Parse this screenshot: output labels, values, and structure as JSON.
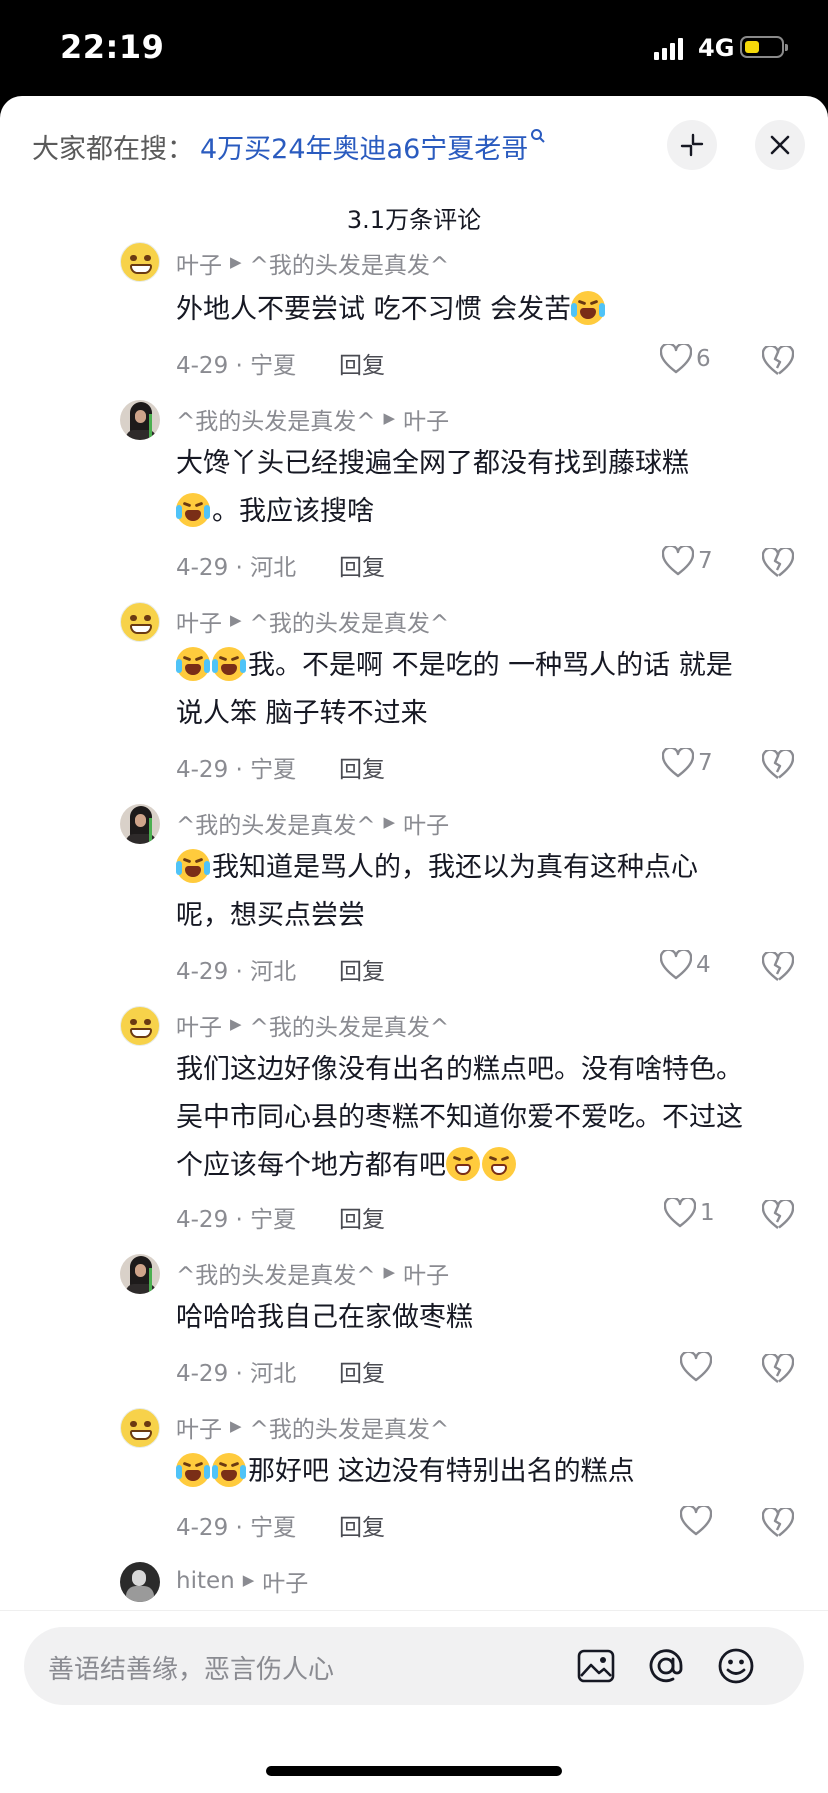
{
  "status": {
    "time": "22:19",
    "network": "4G"
  },
  "search": {
    "prefix": "大家都在搜：",
    "keyword": "4万买24年奥迪a6宁夏老哥"
  },
  "comment_count": "3.1万条评论",
  "comments": [
    {
      "author": "叶子",
      "reply_to": "^我的头发是真发^",
      "text": "外地人不要尝试 吃不习惯 会发苦",
      "date": "4-29 · 宁夏",
      "reply_label": "回复",
      "likes": "6"
    },
    {
      "author": "^我的头发是真发^",
      "reply_to": "叶子",
      "text_line1": "大馋丫头已经搜遍全网了都没有找到藤球糕",
      "text_line2": "。我应该搜啥",
      "date": "4-29 · 河北",
      "reply_label": "回复",
      "likes": "7"
    },
    {
      "author": "叶子",
      "reply_to": "^我的头发是真发^",
      "text_line1": "我。不是啊  不是吃的 一种骂人的话 就是",
      "text_line2": "说人笨 脑子转不过来",
      "date": "4-29 · 宁夏",
      "reply_label": "回复",
      "likes": "7"
    },
    {
      "author": "^我的头发是真发^",
      "reply_to": "叶子",
      "text_line1": "我知道是骂人的，我还以为真有这种点心",
      "text_line2": "呢，想买点尝尝",
      "date": "4-29 · 河北",
      "reply_label": "回复",
      "likes": "4"
    },
    {
      "author": "叶子",
      "reply_to": "^我的头发是真发^",
      "text_line1": "我们这边好像没有出名的糕点吧。没有啥特色。",
      "text_line2": "吴中市同心县的枣糕不知道你爱不爱吃。不过这",
      "text_line3": "个应该每个地方都有吧",
      "date": "4-29 · 宁夏",
      "reply_label": "回复",
      "likes": "1"
    },
    {
      "author": "^我的头发是真发^",
      "reply_to": "叶子",
      "text": "哈哈哈我自己在家做枣糕",
      "date": "4-29 · 河北",
      "reply_label": "回复",
      "likes": ""
    },
    {
      "author": "叶子",
      "reply_to": "^我的头发是真发^",
      "text": "那好吧 这边没有特别出名的糕点",
      "date": "4-29 · 宁夏",
      "reply_label": "回复",
      "likes": ""
    },
    {
      "author": "hiten",
      "reply_to": "叶子"
    }
  ],
  "input": {
    "placeholder": "善语结善缘，恶言伤人心"
  },
  "icons": {
    "collapse": "collapse-icon",
    "close": "close-icon",
    "search": "search-icon",
    "like": "heart-icon",
    "dislike": "broken-heart-icon",
    "image": "image-icon",
    "mention": "at-icon",
    "emoji": "emoji-icon"
  },
  "colors": {
    "link": "#2a5bbf",
    "meta": "#8a8b91",
    "text": "#161823",
    "battery": "#f5d90a"
  }
}
